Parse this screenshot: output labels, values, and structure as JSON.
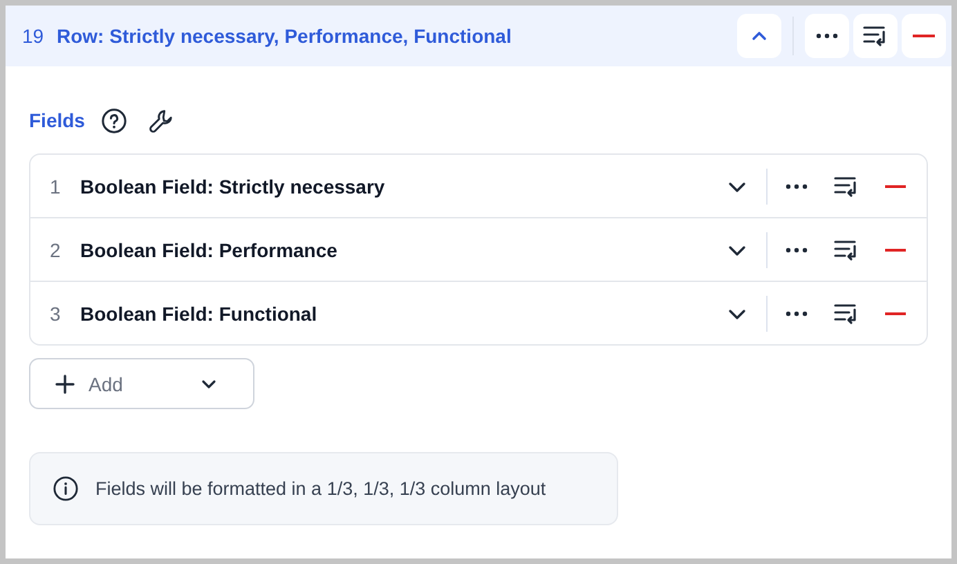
{
  "row": {
    "number": "19",
    "title": "Row: Strictly necessary, Performance, Functional",
    "expanded": true
  },
  "fields_label": "Fields",
  "fields": [
    {
      "number": "1",
      "label": "Boolean Field: Strictly necessary"
    },
    {
      "number": "2",
      "label": "Boolean Field: Performance"
    },
    {
      "number": "3",
      "label": "Boolean Field: Functional"
    }
  ],
  "add_button": "Add",
  "info": "Fields will be formatted in a 1/3, 1/3, 1/3 column layout"
}
